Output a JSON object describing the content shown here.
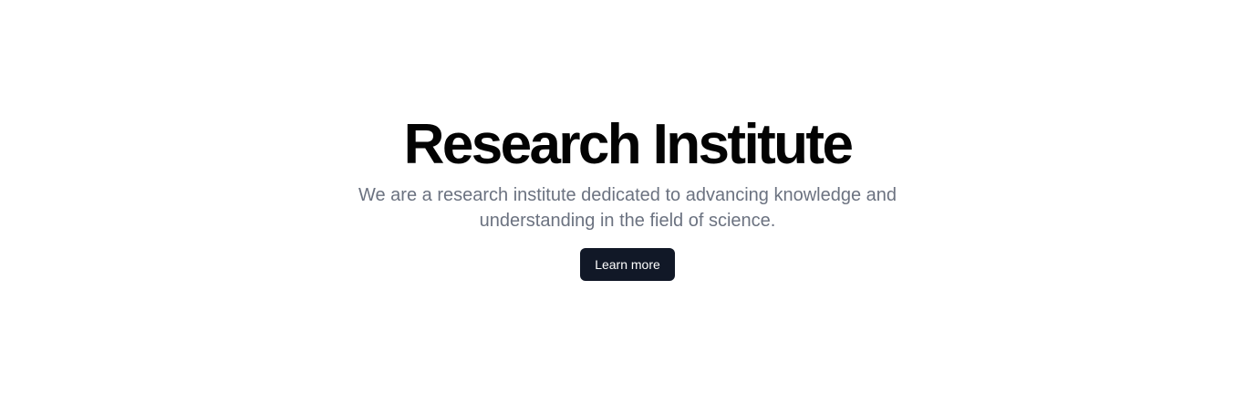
{
  "hero": {
    "title": "Research Institute",
    "subtitle": "We are a research institute dedicated to advancing knowledge and understanding in the field of science.",
    "cta_label": "Learn more"
  },
  "colors": {
    "background": "#ffffff",
    "title": "#030303",
    "subtitle": "#6b7280",
    "button_bg": "#111827",
    "button_text": "#ffffff"
  }
}
